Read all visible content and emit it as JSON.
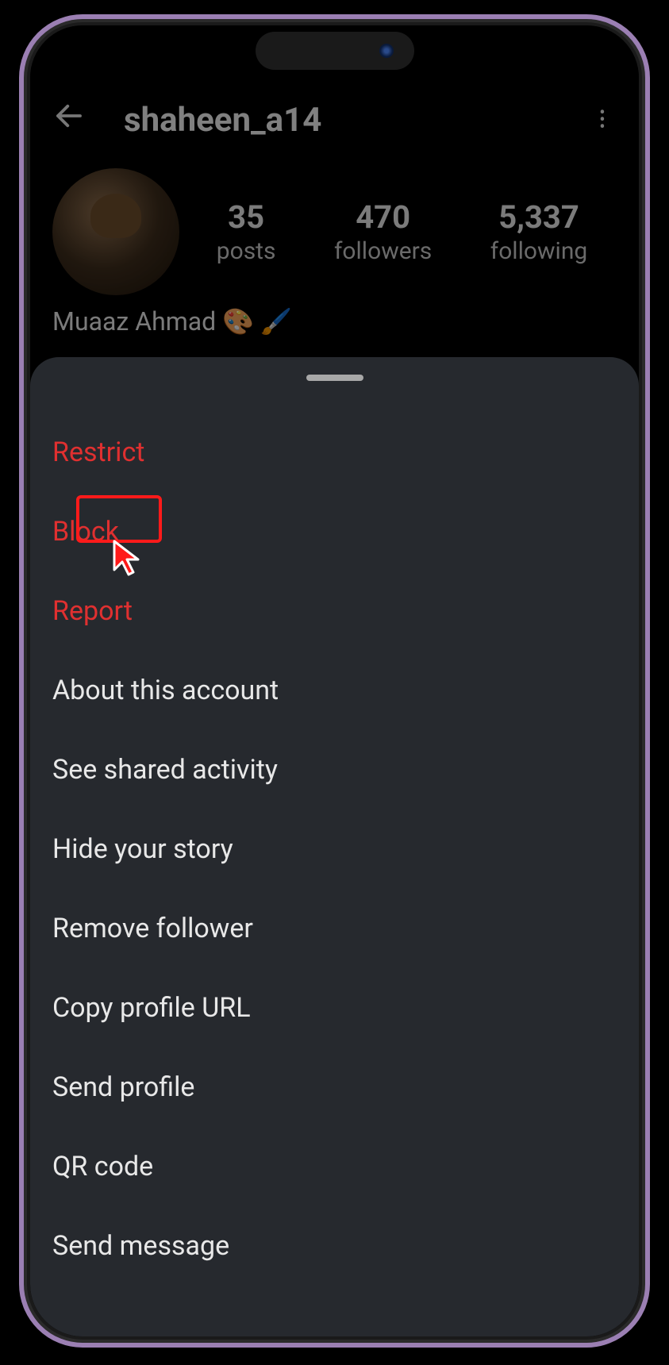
{
  "header": {
    "username": "shaheen_a14"
  },
  "stats": {
    "posts": {
      "count": "35",
      "label": "posts"
    },
    "followers": {
      "count": "470",
      "label": "followers"
    },
    "following": {
      "count": "5,337",
      "label": "following"
    }
  },
  "profile": {
    "display_name": "Muaaz Ahmad 🎨 🖌️"
  },
  "sheet": {
    "items": [
      {
        "label": "Restrict",
        "danger": true
      },
      {
        "label": "Block",
        "danger": true,
        "highlighted": true
      },
      {
        "label": "Report",
        "danger": true
      },
      {
        "label": "About this account",
        "danger": false
      },
      {
        "label": "See shared activity",
        "danger": false
      },
      {
        "label": "Hide your story",
        "danger": false
      },
      {
        "label": "Remove follower",
        "danger": false
      },
      {
        "label": "Copy profile URL",
        "danger": false
      },
      {
        "label": "Send profile",
        "danger": false
      },
      {
        "label": "QR code",
        "danger": false
      },
      {
        "label": "Send message",
        "danger": false
      }
    ]
  }
}
